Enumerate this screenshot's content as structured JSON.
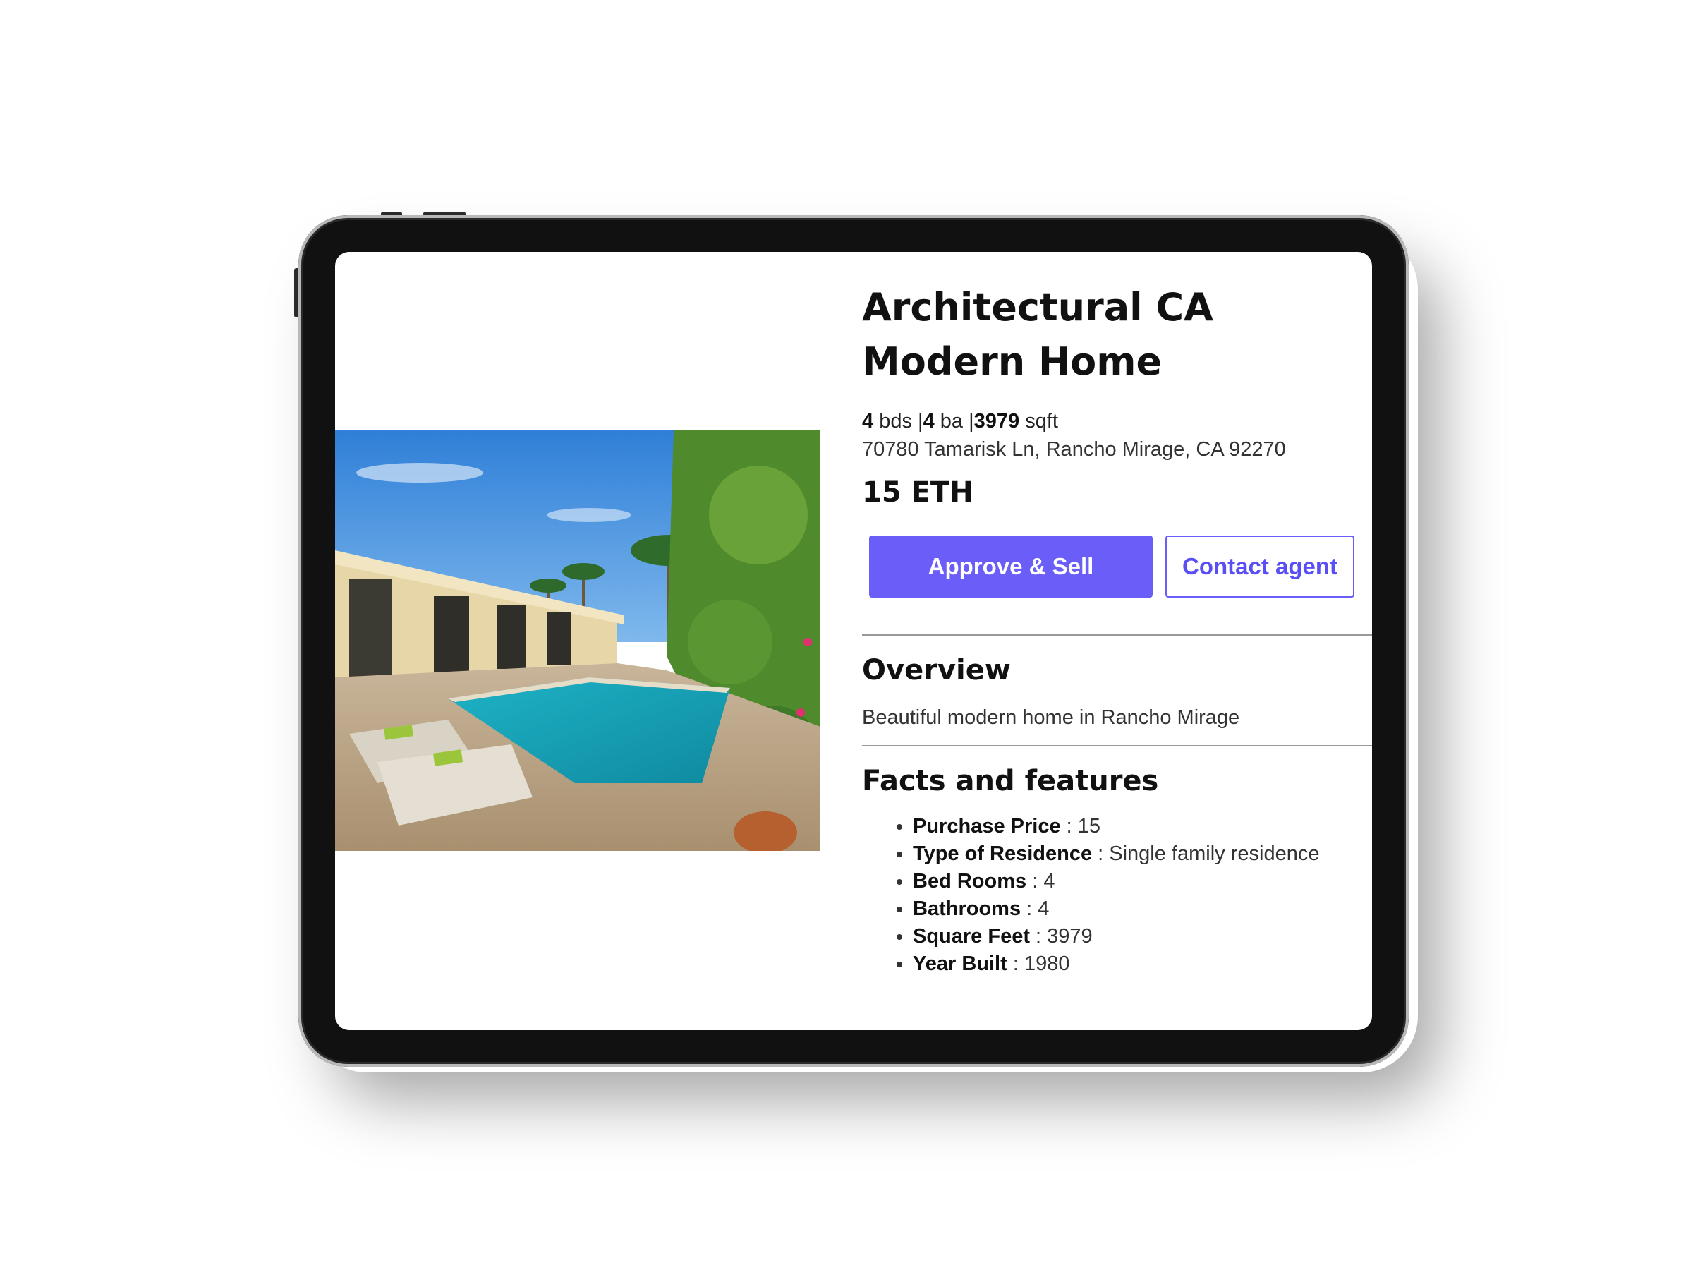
{
  "listing": {
    "title": "Architectural CA Modern Home",
    "beds": "4",
    "beds_unit": "bds",
    "baths": "4",
    "baths_unit": "ba",
    "sqft": "3979",
    "sqft_unit": "sqft",
    "address": "70780 Tamarisk Ln, Rancho Mirage, CA 92270",
    "price": "15 ETH"
  },
  "actions": {
    "approve_label": "Approve & Sell",
    "contact_label": "Contact agent"
  },
  "overview": {
    "heading": "Overview",
    "text": "Beautiful modern home in Rancho Mirage"
  },
  "facts": {
    "heading": "Facts and features",
    "items": [
      {
        "label": "Purchase Price",
        "value": "15"
      },
      {
        "label": "Type of Residence",
        "value": "Single family residence"
      },
      {
        "label": "Bed Rooms",
        "value": "4"
      },
      {
        "label": "Bathrooms",
        "value": "4"
      },
      {
        "label": "Square Feet",
        "value": "3979"
      },
      {
        "label": "Year Built",
        "value": "1980"
      }
    ]
  },
  "colors": {
    "accent": "#6b5ef8",
    "bezel": "#111111"
  },
  "icons": {
    "photo": "house-pool-photo"
  }
}
